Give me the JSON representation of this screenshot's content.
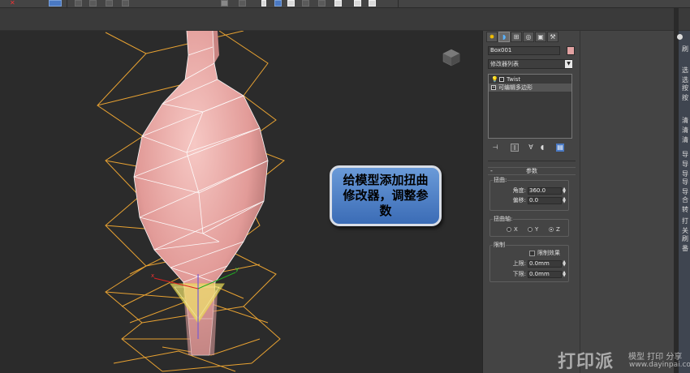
{
  "colors": {
    "viewport_bg": "#2b2b2b",
    "wire_orange": "#e8a232",
    "mesh_pink": "#e7a7a5",
    "callout_blue": "#4a7cc4",
    "accent_blue": "#4a79c3"
  },
  "toolbar": {
    "icons": [
      "close-x-icon",
      "arrow-icon",
      "select-icon",
      "transform-icon",
      "snap-icon",
      "render-icon",
      "layer-icon",
      "material-icon"
    ]
  },
  "callout": {
    "text_line1": "给模型添加扭曲",
    "text_line2": "修改器，调整参",
    "text_line3": "数"
  },
  "command_panel": {
    "tabs": [
      "create-tab-icon",
      "modify-tab-icon",
      "hierarchy-tab-icon",
      "motion-tab-icon",
      "display-tab-icon",
      "utilities-tab-icon"
    ],
    "object_name": "Box001",
    "modifier_list_label": "修改器列表",
    "stack": {
      "items": [
        {
          "label": "Twist",
          "expand": "-"
        },
        {
          "label": "可编辑多边形",
          "expand": "+"
        }
      ]
    },
    "parameters": {
      "title": "参数",
      "twist_group": "扭曲:",
      "angle_label": "角度:",
      "angle_value": "360.0",
      "bias_label": "偏移:",
      "bias_value": "0.0",
      "axis_group": "扭曲轴:",
      "axis_x": "X",
      "axis_y": "Y",
      "axis_z": "Z",
      "selected_axis": "Z",
      "limits_group": "限制",
      "limit_effect_label": "限制效果",
      "limit_effect_checked": false,
      "upper_label": "上限:",
      "upper_value": "0.0mm",
      "lower_label": "下限:",
      "lower_value": "0.0mm"
    }
  },
  "far_panel": {
    "chars": [
      "刷",
      "选",
      "选",
      "按",
      "按",
      "清",
      "清",
      "清",
      "导",
      "导",
      "导",
      "导",
      "导",
      "合",
      "转",
      "打",
      "关",
      "刷",
      "番"
    ]
  },
  "watermark": {
    "logo": "打印派",
    "tagline": "模型 打印 分享",
    "url": "www.dayinpai.com"
  }
}
